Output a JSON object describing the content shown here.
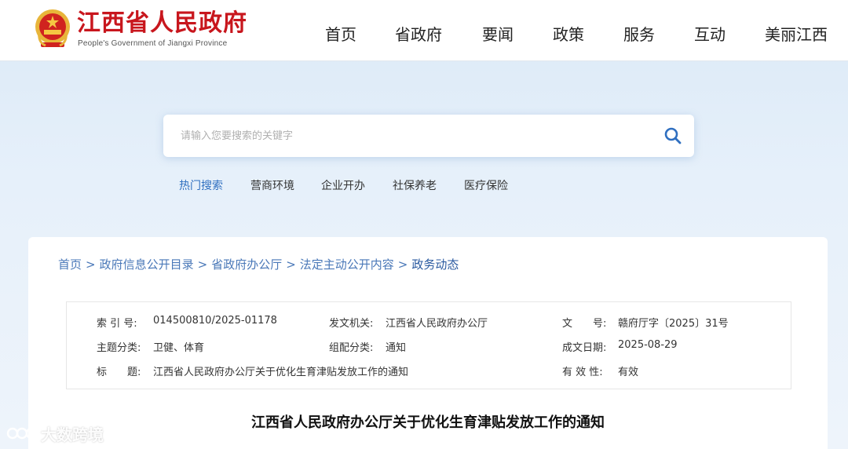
{
  "header": {
    "title": "江西省人民政府",
    "subtitle": "People's Government of Jiangxi Province",
    "brand_color": "#c8161d",
    "nav": [
      {
        "label": "首页"
      },
      {
        "label": "省政府"
      },
      {
        "label": "要闻"
      },
      {
        "label": "政策"
      },
      {
        "label": "服务"
      },
      {
        "label": "互动"
      },
      {
        "label": "美丽江西"
      }
    ]
  },
  "search": {
    "placeholder": "请输入您要搜索的关键字",
    "icon": "search-icon",
    "hot_label": "热门搜索",
    "hot_items": [
      {
        "label": "营商环境"
      },
      {
        "label": "企业开办"
      },
      {
        "label": "社保养老"
      },
      {
        "label": "医疗保险"
      }
    ]
  },
  "breadcrumb": {
    "items": [
      "首页",
      "政府信息公开目录",
      "省政府办公厅",
      "法定主动公开内容"
    ],
    "current": "政务动态",
    "separator": ">"
  },
  "meta": {
    "index_key": "索 引 号:",
    "index_val": "014500810/2025-01178",
    "issuer_key": "发文机关:",
    "issuer_val": "江西省人民政府办公厅",
    "docno_key": "文　　号:",
    "docno_val": "赣府厅字〔2025〕31号",
    "topic_key": "主题分类:",
    "topic_val": "卫健、体育",
    "category_key": "组配分类:",
    "category_val": "通知",
    "date_key": "成文日期:",
    "date_val": "2025-08-29",
    "title_key": "标　　题:",
    "title_val": "江西省人民政府办公厅关于优化生育津贴发放工作的通知",
    "validity_key": "有 效 性:",
    "validity_val": "有效"
  },
  "document": {
    "title": "江西省人民政府办公厅关于优化生育津贴发放工作的通知"
  },
  "watermark": {
    "text": "大数跨境"
  }
}
